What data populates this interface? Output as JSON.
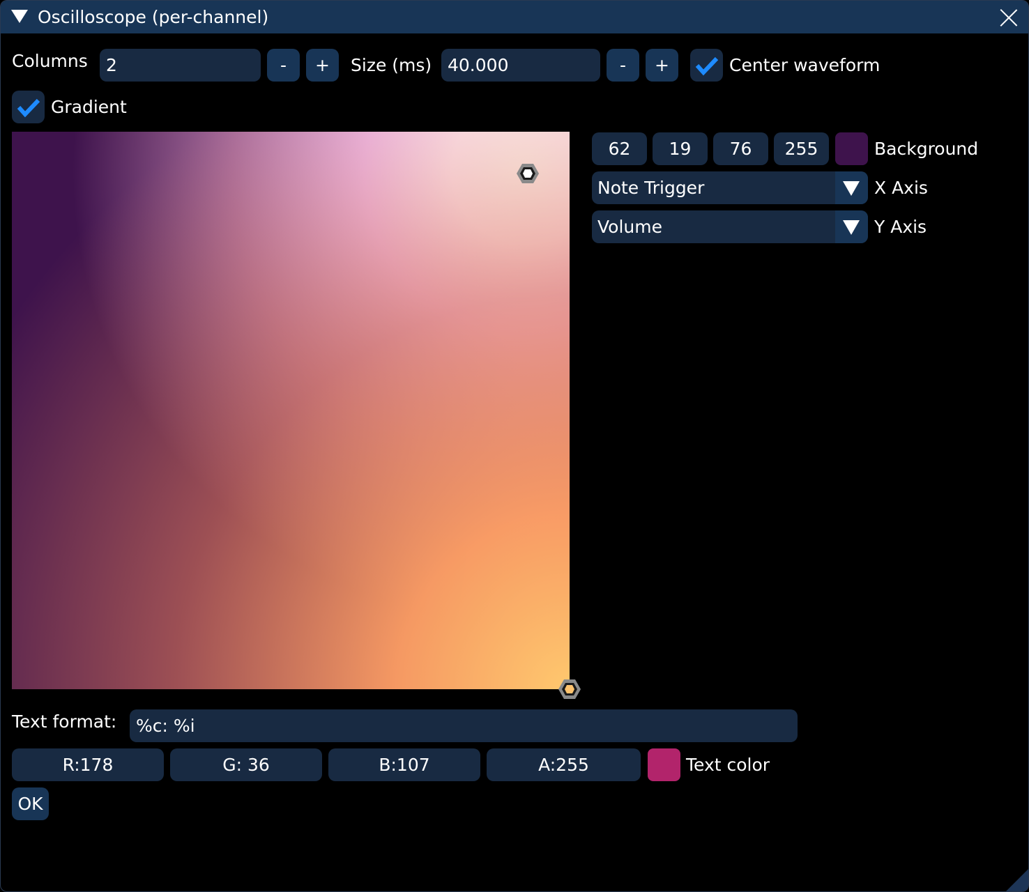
{
  "window": {
    "title": "Oscilloscope (per-channel)"
  },
  "settings": {
    "columns_label": "Columns",
    "columns_value": "2",
    "decrement_label": "-",
    "increment_label": "+",
    "size_label": "Size (ms)",
    "size_value": "40.000",
    "center_waveform_label": "Center waveform",
    "center_waveform_checked": true,
    "gradient_label": "Gradient",
    "gradient_checked": true
  },
  "gradient_editor": {
    "background": {
      "r": "62",
      "g": "19",
      "b": "76",
      "a": "255",
      "label": "Background",
      "color": "#3e134c"
    },
    "x_axis": {
      "selected": "Note Trigger",
      "label": "X Axis"
    },
    "y_axis": {
      "selected": "Volume",
      "label": "Y Axis"
    },
    "points": [
      {
        "name": "white-point",
        "color": "#ffffff"
      },
      {
        "name": "orange-point",
        "color": "#ffc36e"
      }
    ]
  },
  "text": {
    "format_label": "Text format:",
    "format_value": "%c: %i",
    "r": "R:178",
    "g": "G: 36",
    "b": "B:107",
    "a": "A:255",
    "color_label": "Text color",
    "color": "#b2246b"
  },
  "ok_label": "OK"
}
